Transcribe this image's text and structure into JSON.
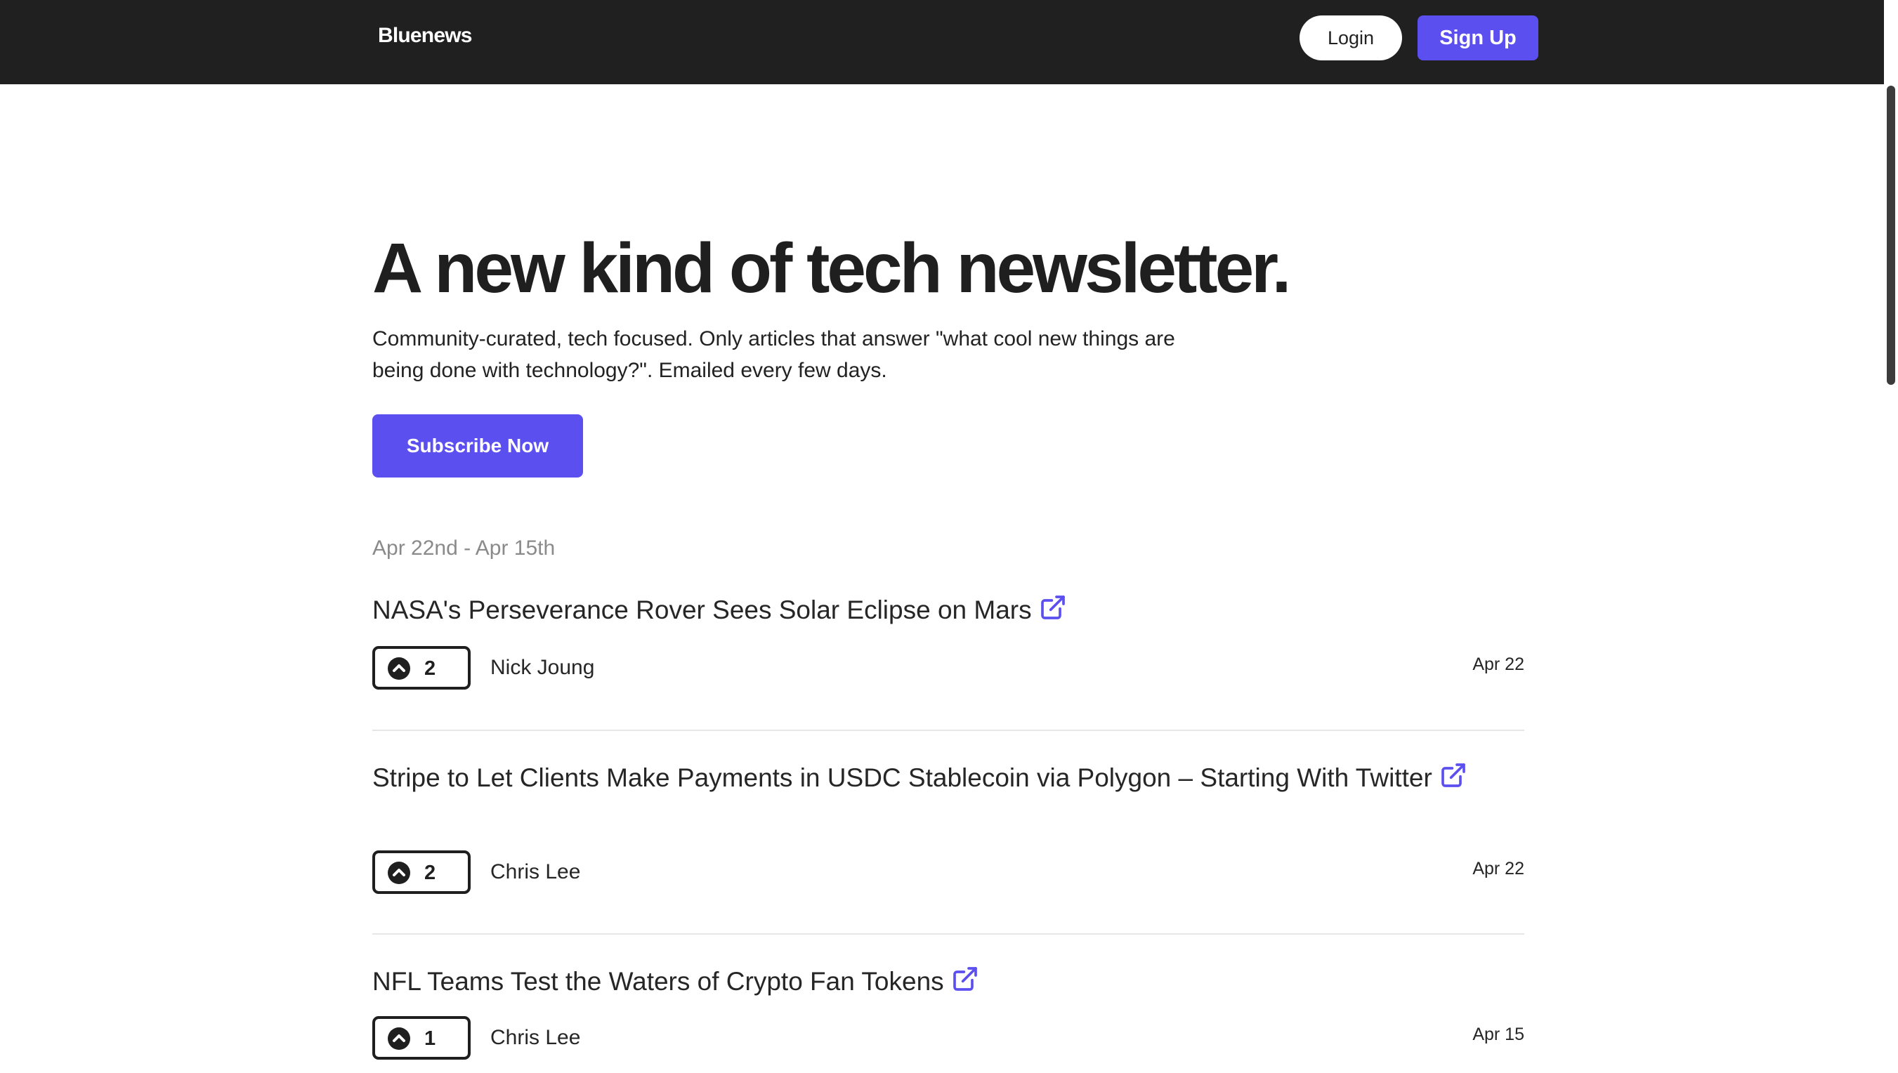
{
  "nav": {
    "brand": "Bluenews",
    "login_label": "Login",
    "signup_label": "Sign Up"
  },
  "hero": {
    "title": "A new kind of tech newsletter.",
    "subtitle": "Community-curated, tech focused. Only articles that answer \"what cool new things are being done with technology?\". Emailed every few days.",
    "cta_label": "Subscribe Now"
  },
  "date_range": "Apr 22nd - Apr 15th",
  "articles": [
    {
      "title": "NASA's Perseverance Rover Sees Solar Eclipse on Mars",
      "votes": "2",
      "author": "Nick Joung",
      "date": "Apr 22"
    },
    {
      "title": "Stripe to Let Clients Make Payments in USDC Stablecoin via Polygon – Starting With Twitter",
      "votes": "2",
      "author": "Chris Lee",
      "date": "Apr 22"
    },
    {
      "title": "NFL Teams Test the Waters of Crypto Fan Tokens",
      "votes": "1",
      "author": "Chris Lee",
      "date": "Apr 15"
    }
  ],
  "icons": {
    "external_link": "external-link-icon",
    "upvote": "upvote-chevron-icon"
  },
  "colors": {
    "accent": "#5c4ff0",
    "topbar": "#202020",
    "muted_text": "#8a8a8a"
  }
}
